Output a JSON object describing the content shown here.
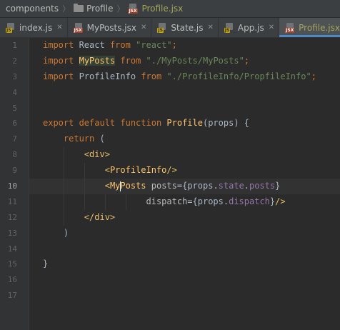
{
  "breadcrumb": {
    "items": [
      "components",
      "Profile",
      "Profile.jsx"
    ]
  },
  "tabs": [
    {
      "label": "index.js",
      "type": "js"
    },
    {
      "label": "MyPosts.jsx",
      "type": "jsx"
    },
    {
      "label": "State.js",
      "type": "js"
    },
    {
      "label": "App.js",
      "type": "js"
    },
    {
      "label": "Profile.jsx",
      "type": "jsx",
      "active": true
    }
  ],
  "file_badges": {
    "js": "JS",
    "jsx": "JSX"
  },
  "editor": {
    "current_line": 10,
    "lines": [
      {
        "n": "1",
        "t": [
          [
            "kw",
            "import"
          ],
          [
            "plain",
            " React "
          ],
          [
            "kw",
            "from"
          ],
          [
            "str",
            " \"react\""
          ],
          [
            "kw",
            ";"
          ]
        ]
      },
      {
        "n": "2",
        "t": [
          [
            "kw",
            "import"
          ],
          [
            "plain",
            " "
          ],
          [
            "comp-hl",
            "MyPosts"
          ],
          [
            "plain",
            " "
          ],
          [
            "kw",
            "from"
          ],
          [
            "str",
            " \"./MyPosts/MyPosts\""
          ],
          [
            "kw",
            ";"
          ]
        ]
      },
      {
        "n": "3",
        "t": [
          [
            "kw",
            "import"
          ],
          [
            "plain",
            " ProfileInfo "
          ],
          [
            "kw",
            "from"
          ],
          [
            "str",
            " \"./ProfileInfo/PropfileInfo\""
          ],
          [
            "kw",
            ";"
          ]
        ]
      },
      {
        "n": "4",
        "t": []
      },
      {
        "n": "5",
        "t": []
      },
      {
        "n": "6",
        "t": [
          [
            "kw",
            "export default function "
          ],
          [
            "fn",
            "Profile"
          ],
          [
            "plain",
            "(props) {"
          ]
        ]
      },
      {
        "n": "7",
        "t": [
          [
            "plain",
            "    "
          ],
          [
            "kw",
            "return"
          ],
          [
            "plain",
            " ("
          ]
        ]
      },
      {
        "n": "8",
        "t": [
          [
            "plain",
            "        "
          ],
          [
            "tag",
            "<div>"
          ]
        ]
      },
      {
        "n": "9",
        "t": [
          [
            "plain",
            "            "
          ],
          [
            "tag",
            "<"
          ],
          [
            "comp",
            "ProfileInfo"
          ],
          [
            "tag",
            "/>"
          ]
        ]
      },
      {
        "n": "10",
        "t": [
          [
            "plain",
            "            "
          ],
          [
            "tag",
            "<"
          ],
          [
            "comp",
            "My"
          ],
          [
            "caret",
            ""
          ],
          [
            "comp",
            "Posts"
          ],
          [
            "plain",
            " "
          ],
          [
            "attr",
            "posts"
          ],
          [
            "plain",
            "={props."
          ],
          [
            "prop",
            "state"
          ],
          [
            "plain",
            "."
          ],
          [
            "prop",
            "posts"
          ],
          [
            "plain",
            "}"
          ]
        ]
      },
      {
        "n": "11",
        "t": [
          [
            "plain",
            "                    "
          ],
          [
            "attr",
            "dispatch"
          ],
          [
            "plain",
            "={props."
          ],
          [
            "prop",
            "dispatch"
          ],
          [
            "plain",
            "}"
          ],
          [
            "tag",
            "/>"
          ]
        ]
      },
      {
        "n": "12",
        "t": [
          [
            "plain",
            "        "
          ],
          [
            "tag",
            "</div>"
          ]
        ]
      },
      {
        "n": "13",
        "t": [
          [
            "plain",
            "    )"
          ]
        ]
      },
      {
        "n": "14",
        "t": []
      },
      {
        "n": "15",
        "t": [
          [
            "plain",
            "}"
          ]
        ]
      },
      {
        "n": "16",
        "t": []
      },
      {
        "n": "17",
        "t": []
      }
    ]
  }
}
